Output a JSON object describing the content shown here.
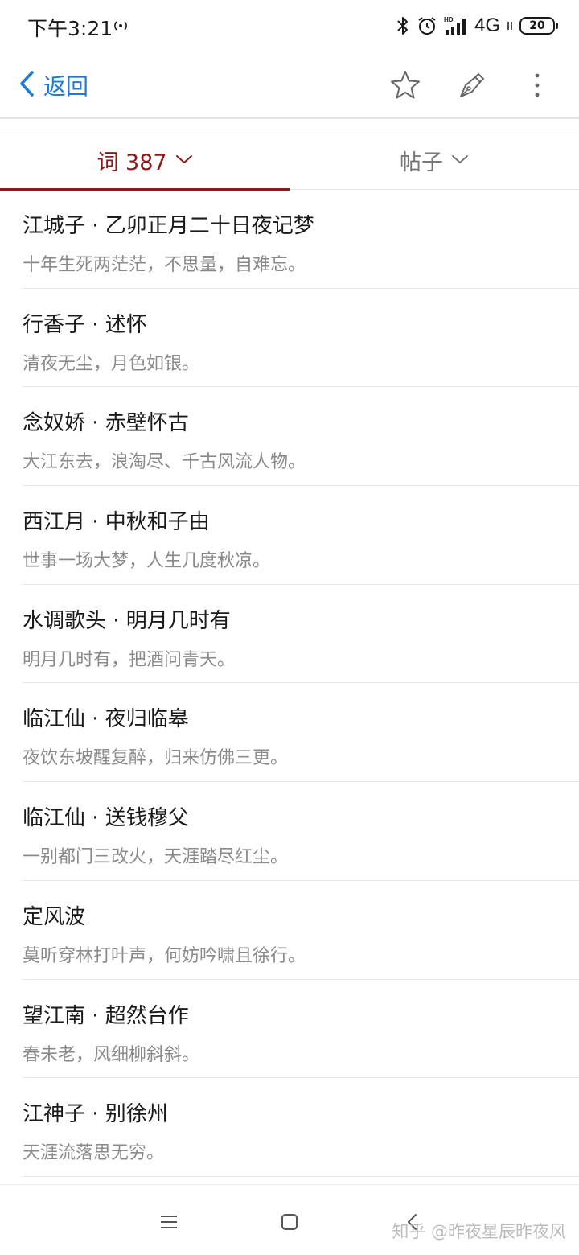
{
  "status_bar": {
    "time": "下午3:21",
    "network": "4G",
    "hd_label": "HD",
    "battery": "20"
  },
  "top_nav": {
    "back_label": "返回",
    "icons": [
      "star-icon",
      "pen-nib-icon",
      "more-vertical-icon"
    ],
    "accent_color": "#1e7ad9"
  },
  "tabs": [
    {
      "label": "词 387",
      "active": true
    },
    {
      "label": "帖子",
      "active": false
    }
  ],
  "active_tab_color": "#8b1a1a",
  "list": [
    {
      "title": "江城子 · 乙卯正月二十日夜记梦",
      "line": "十年生死两茫茫，不思量，自难忘。"
    },
    {
      "title": "行香子 · 述怀",
      "line": "清夜无尘，月色如银。"
    },
    {
      "title": "念奴娇 · 赤壁怀古",
      "line": "大江东去，浪淘尽、千古风流人物。"
    },
    {
      "title": "西江月 · 中秋和子由",
      "line": "世事一场大梦，人生几度秋凉。"
    },
    {
      "title": "水调歌头 · 明月几时有",
      "line": "明月几时有，把酒问青天。"
    },
    {
      "title": "临江仙 · 夜归临皋",
      "line": "夜饮东坡醒复醉，归来仿佛三更。"
    },
    {
      "title": "临江仙 · 送钱穆父",
      "line": "一别都门三改火，天涯踏尽红尘。"
    },
    {
      "title": "定风波",
      "line": "莫听穿林打叶声，何妨吟啸且徐行。"
    },
    {
      "title": "望江南 · 超然台作",
      "line": "春未老，风细柳斜斜。"
    },
    {
      "title": "江神子 · 别徐州",
      "line": "天涯流落思无穷。"
    }
  ],
  "bottom_nav": {
    "icons": [
      "menu-icon",
      "home-square-icon",
      "back-chevron-icon"
    ],
    "watermark": "知乎 @昨夜星辰昨夜风"
  }
}
